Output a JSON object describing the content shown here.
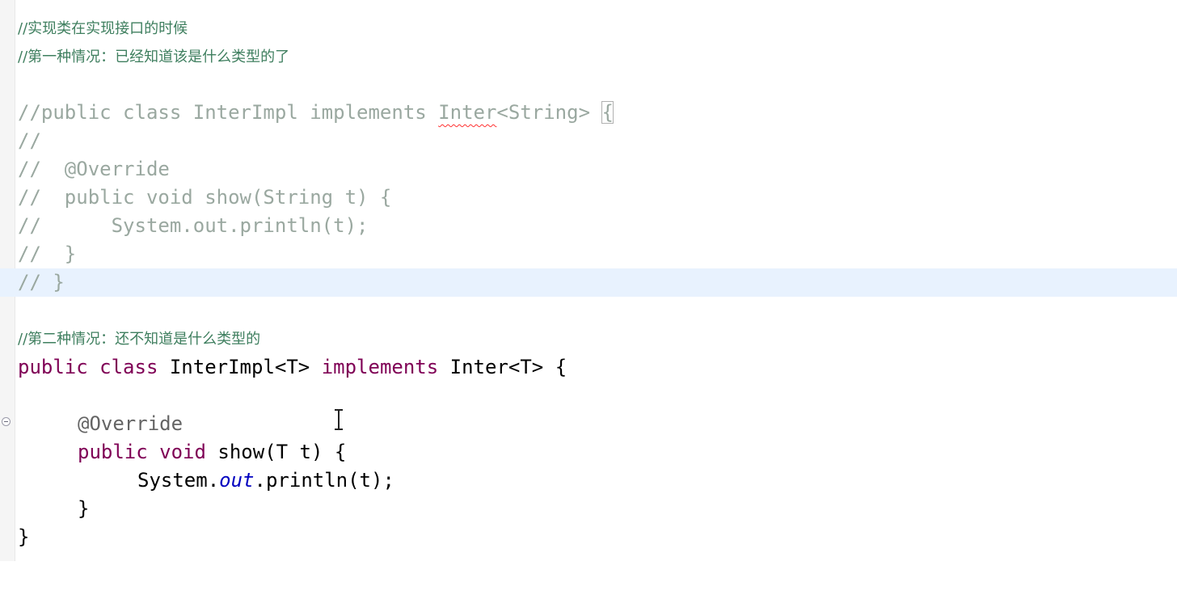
{
  "editor": {
    "lines": {
      "c1": "//实现类在实现接口的时候",
      "c2": "//第一种情况：已经知道该是什么类型的了",
      "l4a": "//public class InterImpl implements ",
      "l4b": "Inter",
      "l4c": "<String> ",
      "l4d": "{",
      "l5": "//",
      "l6": "//  @Override",
      "l7": "//  public void show(String t) {",
      "l8": "//      System.out.println(t);",
      "l9": "//  }",
      "l10": "// }",
      "c3": "//第二种情况：还不知道是什么类型的",
      "k_public": "public",
      "k_class": "class",
      "cls_decl": " InterImpl<T> ",
      "k_implements": "implements",
      "cls_tail": " Inter<T> {",
      "ann_override": "@Override",
      "k_public2": "public",
      "k_void": "void",
      "show_sig": " show(T t) {",
      "sys": "System.",
      "out": "out",
      "println": ".println(t);",
      "close_method": "}",
      "close_class": "}"
    }
  }
}
